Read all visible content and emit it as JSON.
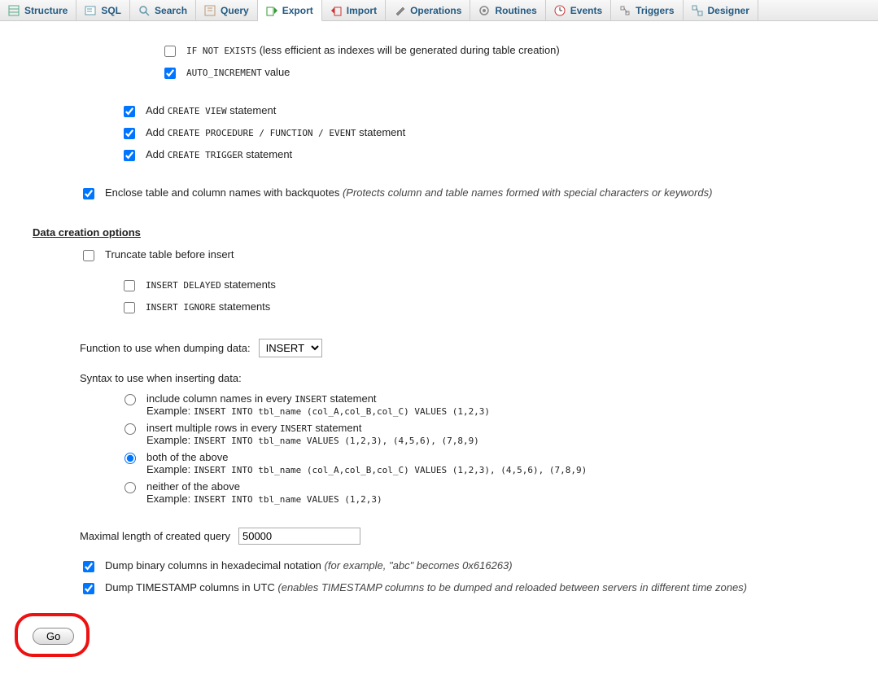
{
  "tabs": [
    {
      "label": "Structure"
    },
    {
      "label": "SQL"
    },
    {
      "label": "Search"
    },
    {
      "label": "Query"
    },
    {
      "label": "Export"
    },
    {
      "label": "Import"
    },
    {
      "label": "Operations"
    },
    {
      "label": "Routines"
    },
    {
      "label": "Events"
    },
    {
      "label": "Triggers"
    },
    {
      "label": "Designer"
    }
  ],
  "opts": {
    "if_not_exists_code": "IF NOT EXISTS",
    "if_not_exists_text": " (less efficient as indexes will be generated during table creation)",
    "auto_increment_code": "AUTO_INCREMENT",
    "auto_increment_text": " value",
    "create_view_pre": "Add ",
    "create_view_code": "CREATE VIEW",
    "create_view_post": " statement",
    "create_proc_pre": "Add ",
    "create_proc_code": "CREATE PROCEDURE / FUNCTION / EVENT",
    "create_proc_post": " statement",
    "create_trigger_pre": "Add ",
    "create_trigger_code": "CREATE TRIGGER",
    "create_trigger_post": " statement",
    "backquotes_text": "Enclose table and column names with backquotes ",
    "backquotes_note": "(Protects column and table names formed with special characters or keywords)"
  },
  "data_section": {
    "heading": "Data creation options",
    "truncate": "Truncate table before insert",
    "insert_delayed_code": "INSERT DELAYED",
    "insert_delayed_text": " statements",
    "insert_ignore_code": "INSERT IGNORE",
    "insert_ignore_text": " statements",
    "function_label": "Function to use when dumping data:",
    "function_option": "INSERT",
    "syntax_label": "Syntax to use when inserting data:",
    "r1_text_a": "include column names in every ",
    "r1_text_b": "INSERT",
    "r1_text_c": " statement",
    "r1_ex_label": "Example: ",
    "r1_ex_code": "INSERT INTO tbl_name (col_A,col_B,col_C) VALUES (1,2,3)",
    "r2_text_a": "insert multiple rows in every ",
    "r2_text_b": "INSERT",
    "r2_text_c": " statement",
    "r2_ex_label": "Example: ",
    "r2_ex_code": "INSERT INTO tbl_name VALUES (1,2,3), (4,5,6), (7,8,9)",
    "r3_text": "both of the above",
    "r3_ex_label": "Example: ",
    "r3_ex_code": "INSERT INTO tbl_name (col_A,col_B,col_C) VALUES (1,2,3), (4,5,6), (7,8,9)",
    "r4_text": "neither of the above",
    "r4_ex_label": "Example: ",
    "r4_ex_code": "INSERT INTO tbl_name VALUES (1,2,3)",
    "maxlen_label": "Maximal length of created query",
    "maxlen_value": "50000",
    "dump_binary_text": "Dump binary columns in hexadecimal notation ",
    "dump_binary_note": "(for example, \"abc\" becomes 0x616263)",
    "dump_ts_text": "Dump TIMESTAMP columns in UTC ",
    "dump_ts_note": "(enables TIMESTAMP columns to be dumped and reloaded between servers in different time zones)"
  },
  "go_button": "Go"
}
